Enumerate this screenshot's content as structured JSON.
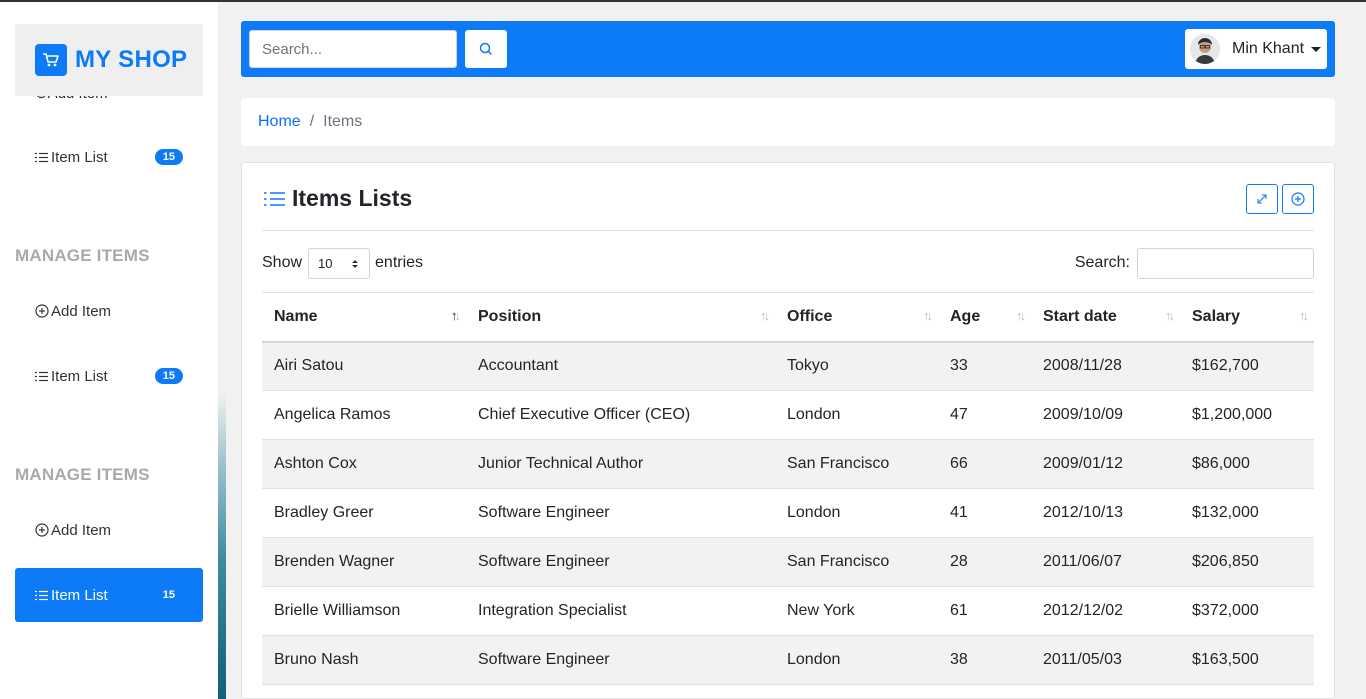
{
  "brand": {
    "name": "MY SHOP",
    "icon": "shopping-cart-icon",
    "color": "#0d7af7"
  },
  "sidebar": {
    "cut_item": "Add Item",
    "groups": [
      {
        "title": "",
        "items": [
          {
            "label": "Item List",
            "badge": "15"
          }
        ]
      },
      {
        "title": "MANAGE ITEMS",
        "items": [
          {
            "label": "Add Item"
          },
          {
            "label": "Item List",
            "badge": "15"
          }
        ]
      },
      {
        "title": "MANAGE ITEMS",
        "items": [
          {
            "label": "Add Item"
          },
          {
            "label": "Item List",
            "badge": "15",
            "active": true
          }
        ]
      }
    ]
  },
  "topbar": {
    "search_placeholder": "Search...",
    "user_name": "Min Khant"
  },
  "breadcrumb": {
    "home": "Home",
    "separator": "/",
    "current": "Items"
  },
  "card": {
    "title": "Items Lists"
  },
  "datatable": {
    "show_label": "Show",
    "entries_value": "10",
    "entries_label": "entries",
    "search_label": "Search:",
    "columns": [
      "Name",
      "Position",
      "Office",
      "Age",
      "Start date",
      "Salary"
    ],
    "rows": [
      [
        "Airi Satou",
        "Accountant",
        "Tokyo",
        "33",
        "2008/11/28",
        "$162,700"
      ],
      [
        "Angelica Ramos",
        "Chief Executive Officer (CEO)",
        "London",
        "47",
        "2009/10/09",
        "$1,200,000"
      ],
      [
        "Ashton Cox",
        "Junior Technical Author",
        "San Francisco",
        "66",
        "2009/01/12",
        "$86,000"
      ],
      [
        "Bradley Greer",
        "Software Engineer",
        "London",
        "41",
        "2012/10/13",
        "$132,000"
      ],
      [
        "Brenden Wagner",
        "Software Engineer",
        "San Francisco",
        "28",
        "2011/06/07",
        "$206,850"
      ],
      [
        "Brielle Williamson",
        "Integration Specialist",
        "New York",
        "61",
        "2012/12/02",
        "$372,000"
      ],
      [
        "Bruno Nash",
        "Software Engineer",
        "London",
        "38",
        "2011/05/03",
        "$163,500"
      ]
    ]
  }
}
